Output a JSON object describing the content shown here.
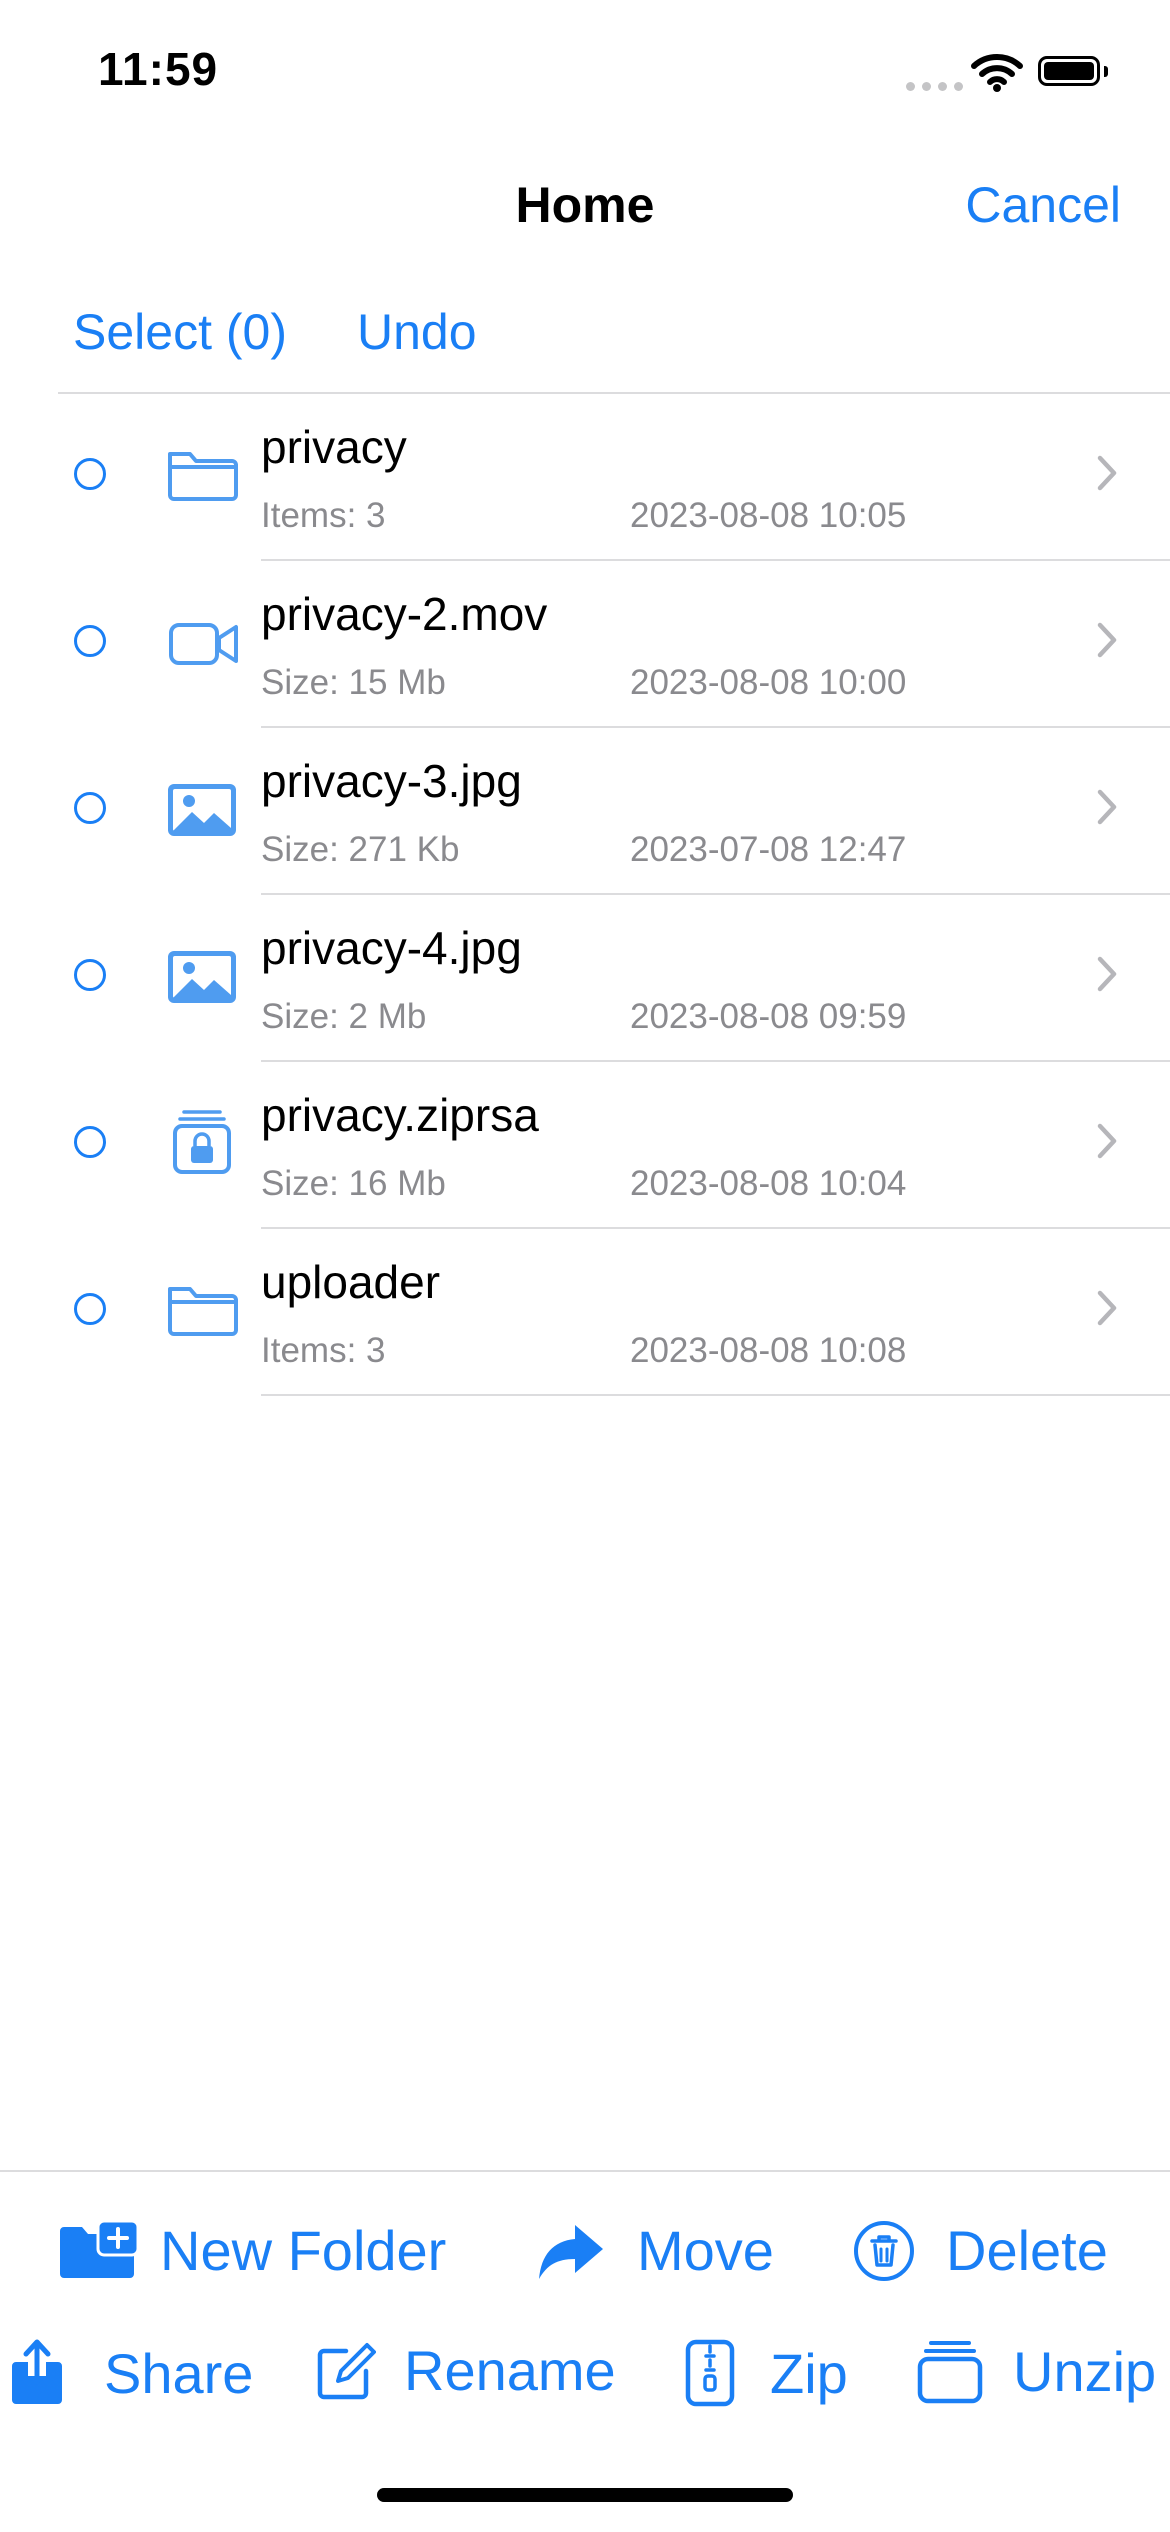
{
  "status_bar": {
    "time": "11:59"
  },
  "nav": {
    "title": "Home",
    "cancel_label": "Cancel"
  },
  "actions": {
    "select_label": "Select (0)",
    "undo_label": "Undo"
  },
  "files": [
    {
      "name": "privacy",
      "meta": "Items: 3",
      "date": "2023-08-08 10:05",
      "icon": "folder-icon"
    },
    {
      "name": "privacy-2.mov",
      "meta": "Size:  15 Mb",
      "date": "2023-08-08 10:00",
      "icon": "video-icon"
    },
    {
      "name": "privacy-3.jpg",
      "meta": "Size:  271 Kb",
      "date": "2023-07-08 12:47",
      "icon": "image-icon"
    },
    {
      "name": "privacy-4.jpg",
      "meta": "Size:  2 Mb",
      "date": "2023-08-08 09:59",
      "icon": "image-icon"
    },
    {
      "name": "privacy.ziprsa",
      "meta": "Size:  16 Mb",
      "date": "2023-08-08 10:04",
      "icon": "encrypted-archive-icon"
    },
    {
      "name": "uploader",
      "meta": "Items: 3",
      "date": "2023-08-08 10:08",
      "icon": "folder-icon"
    }
  ],
  "toolbar": {
    "new_folder_label": "New Folder",
    "move_label": "Move",
    "delete_label": "Delete",
    "share_label": "Share",
    "rename_label": "Rename",
    "zip_label": "Zip",
    "unzip_label": "Unzip"
  },
  "colors": {
    "accent": "#1a7ff5",
    "icon_blue": "#4f9cf0",
    "secondary_text": "#8a8a8e",
    "divider": "#dcdcde"
  }
}
